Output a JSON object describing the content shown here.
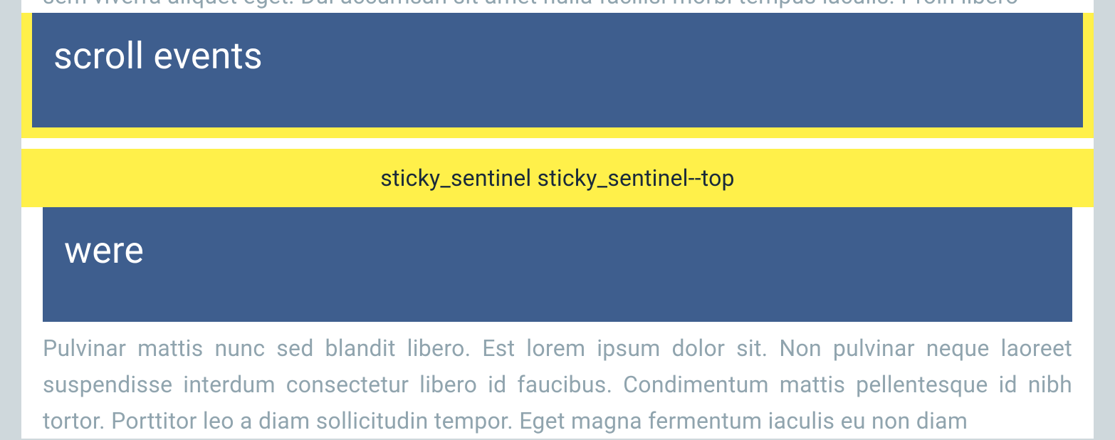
{
  "section1": {
    "partial_text_top": "sem viverra aliquet eget. Dui accumsan sit amet nulla facilisi morbi tempus iaculis. Proin libero",
    "header_title": "scroll events"
  },
  "sentinel": {
    "label": "sticky_sentinel sticky_sentinel--top"
  },
  "section2": {
    "header_title": "were",
    "body_text": "Pulvinar mattis nunc sed blandit libero. Est lorem ipsum dolor sit. Non pulvinar neque laoreet suspendisse interdum consectetur libero id faucibus. Condimentum mattis pellentesque id nibh tortor. Porttitor leo a diam sollicitudin tempor. Eget magna fermentum iaculis eu non diam"
  }
}
